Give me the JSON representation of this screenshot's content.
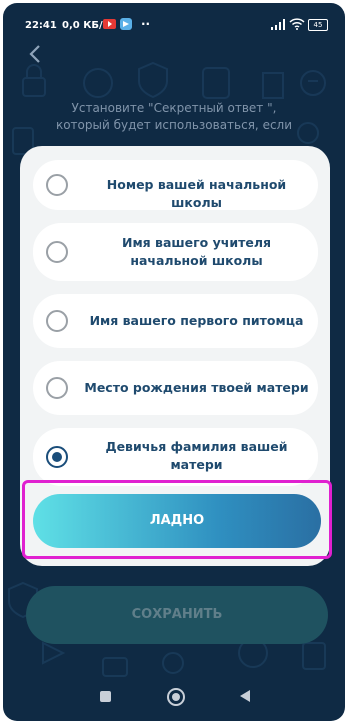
{
  "status_bar": {
    "time": "22:41",
    "speed": "0,0 КБ/с",
    "dots": "··",
    "battery": "45"
  },
  "instruction": "Установите \"Секретный ответ \", который будет использоваться, если",
  "options": [
    {
      "label": "Номер вашей начальной школы",
      "selected": false
    },
    {
      "label": "Имя вашего учителя начальной школы",
      "selected": false
    },
    {
      "label": "Имя вашего первого питомца",
      "selected": false
    },
    {
      "label": "Место рождения твоей матери",
      "selected": false
    },
    {
      "label": "Девичья фамилия вашей матери",
      "selected": true
    }
  ],
  "ok_label": "ЛАДНО",
  "save_label": "СОХРАНИТЬ",
  "colors": {
    "background": "#0f2a44",
    "accent": "#1a4d7a",
    "highlight": "#e020d0",
    "save_button": "#1f5260"
  },
  "icons": [
    "back-arrow-icon",
    "youtube-icon",
    "telegram-icon",
    "signal-icon",
    "wifi-icon",
    "battery-icon"
  ]
}
